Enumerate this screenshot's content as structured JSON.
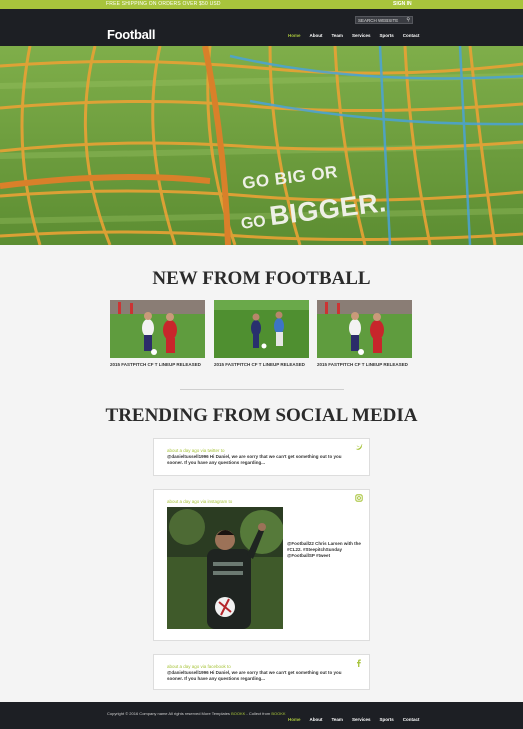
{
  "topbar": {
    "promo": "FREE SHIPPING ON ORDERS OVER $50 USD",
    "signin": "SIGN IN"
  },
  "header": {
    "search_placeholder": "SEARCH WEBSITE",
    "logo": "Football",
    "nav": [
      "Home",
      "About",
      "Team",
      "Services",
      "Sports",
      "Contact"
    ]
  },
  "hero": {
    "slogan_line1": "GO BIG OR",
    "slogan_go": "GO",
    "slogan_bigger": "BIGGER."
  },
  "news": {
    "title": "NEW FROM FOOTBALL",
    "items": [
      {
        "caption": "2015 FASTPITCH CF T LINEUP RELEASED"
      },
      {
        "caption": "2015 FASTPITCH CF T LINEUP RELEASED"
      },
      {
        "caption": "2015 FASTPITCH CF T LINEUP RELEASED"
      }
    ]
  },
  "trending": {
    "title": "TRENDING FROM SOCIAL MEDIA",
    "posts": [
      {
        "when": "about a day ago via twitter to",
        "text": "@danieltussell1996 Hi Daniel, we are sorry that we can't get something out to you sooner. If you have any questions regarding...",
        "icon": "twitter-icon"
      },
      {
        "when": "about a day ago via instagram to",
        "text": "@Football22 Chris Larsen with the #CL22. #SteepitchSunday @FootballSP #tweet",
        "icon": "instagram-icon"
      },
      {
        "when": "about a day ago via facebook to",
        "text": "@danieltussell1996 Hi Daniel, we are sorry that we can't get something out to you sooner. If you have any questions regarding...",
        "icon": "facebook-icon"
      }
    ]
  },
  "footer": {
    "copyright": "Copyright © 2016 Company name All rights reserved More Templates",
    "link1": "BOOKK",
    "mid": " - Collect from",
    "link2": "BOOKK",
    "nav": [
      "Home",
      "About",
      "Team",
      "Services",
      "Sports",
      "Contact"
    ]
  },
  "colors": {
    "accent": "#a8c43c",
    "dark": "#1d1f24",
    "page": "#f4f4f4"
  }
}
